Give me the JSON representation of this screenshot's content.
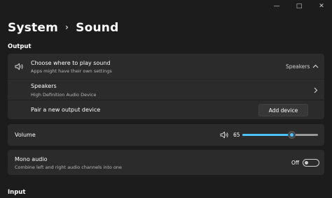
{
  "window": {
    "controls": [
      "minimize",
      "maximize",
      "close"
    ]
  },
  "breadcrumb": {
    "parent": "System",
    "current": "Sound"
  },
  "output": {
    "section_label": "Output",
    "choose": {
      "title": "Choose where to play sound",
      "subtitle": "Apps might have their own settings",
      "selected": "Speakers",
      "icon": "speaker-icon",
      "chevron": "chevron-up-icon"
    },
    "device": {
      "title": "Speakers",
      "subtitle": "High Definition Audio Device",
      "chevron": "chevron-right-icon"
    },
    "pair": {
      "label": "Pair a new output device",
      "button": "Add device"
    }
  },
  "volume": {
    "label": "Volume",
    "value_text": "65",
    "value": 65,
    "icon": "speaker-icon",
    "accent": "#4cc2ff"
  },
  "mono": {
    "title": "Mono audio",
    "subtitle": "Combine left and right audio channels into one",
    "state_label": "Off",
    "enabled": false
  },
  "input": {
    "section_label": "Input"
  }
}
